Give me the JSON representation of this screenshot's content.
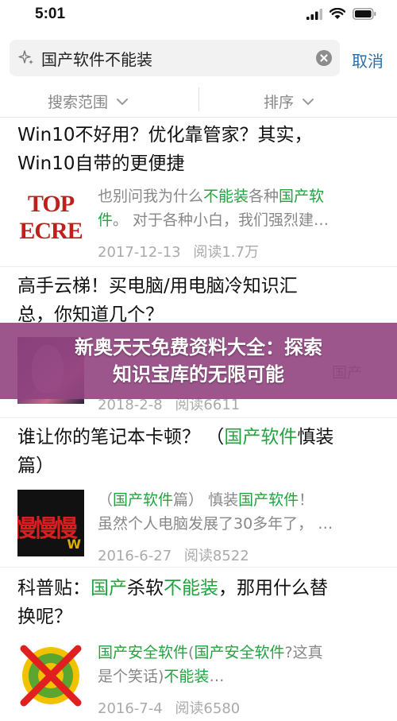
{
  "status_bar": {
    "time": "5:01"
  },
  "search": {
    "query": "国产软件不能装",
    "cancel_label": "取消"
  },
  "filters": {
    "scope_label": "搜索范围",
    "sort_label": "排序"
  },
  "results": [
    {
      "title_line1": "Win10不好用？优化靠管家？其实，",
      "title_line2": "Win10自带的更便捷",
      "thumb_text_1": "TOP",
      "thumb_text_2": "ECRE",
      "snippet_1a": "也别问我为什么",
      "snippet_1b": "不能装",
      "snippet_1c": "各种",
      "snippet_1d": "国产软",
      "snippet_2a": "件",
      "snippet_2b": "。 对于各种小白，我们强烈建…",
      "date": "2017-12-13",
      "reads": "阅读1.7万"
    },
    {
      "title_line1": "高手云梯！买电脑/用电脑冷知识汇",
      "title_line2": "总，你知道几个？",
      "snippet_tail": "国产",
      "date": "2018-2-8",
      "reads": "阅读6611"
    },
    {
      "title_line1a": "谁让你的笔记本卡顿？ （",
      "title_line1b": "国产软件",
      "title_line1c": "慎装",
      "title_line2": "篇）",
      "thumb_text": "慢慢慢",
      "thumb_corner": "W",
      "snippet_1a": "（",
      "snippet_1b": "国产软件",
      "snippet_1c": "篇） 慎装",
      "snippet_1d": "国产软件",
      "snippet_1e": "！",
      "snippet_2": "虽然个人电脑发展了30多年了， …",
      "date": "2016-6-27",
      "reads": "阅读8522"
    },
    {
      "title_line1a": "科普贴：",
      "title_line1b": "国产",
      "title_line1c": "杀软",
      "title_line1d": "不能装",
      "title_line1e": "，那用什么替",
      "title_line2": "换呢？",
      "snippet_1a": "国产",
      "snippet_1b": "安全",
      "snippet_1c": "软件",
      "snippet_1d": "(",
      "snippet_1e": "国产",
      "snippet_1f": "安全",
      "snippet_1g": "软件",
      "snippet_1h": "?这真",
      "snippet_2a": "是个笑话)",
      "snippet_2b": "不能装",
      "snippet_2c": "…",
      "date": "2016-7-4",
      "reads": "阅读6580"
    }
  ],
  "overlay": {
    "line1": "新奥天天免费资料大全：探索",
    "line2": "知识宝库的无限可能"
  },
  "colors": {
    "highlight": "#22a340",
    "link": "#2b6ea8",
    "overlay": "#914480"
  }
}
